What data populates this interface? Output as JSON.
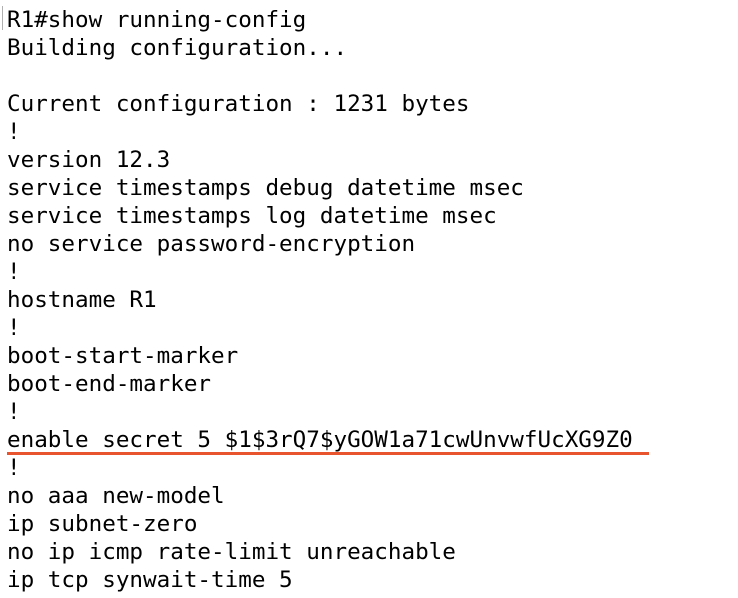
{
  "terminal": {
    "lines": [
      "R1#show running-config",
      "Building configuration...",
      "",
      "Current configuration : 1231 bytes",
      "!",
      "version 12.3",
      "service timestamps debug datetime msec",
      "service timestamps log datetime msec",
      "no service password-encryption",
      "!",
      "hostname R1",
      "!",
      "boot-start-marker",
      "boot-end-marker",
      "!",
      "enable secret 5 $1$3rQ7$yGOW1a71cwUnvwfUcXG9Z0",
      "!",
      "no aaa new-model",
      "ip subnet-zero",
      "no ip icmp rate-limit unreachable",
      "ip tcp synwait-time 5"
    ],
    "highlight_color": "#e8542e",
    "text_color": "#000000",
    "background_color": "#ffffff"
  }
}
